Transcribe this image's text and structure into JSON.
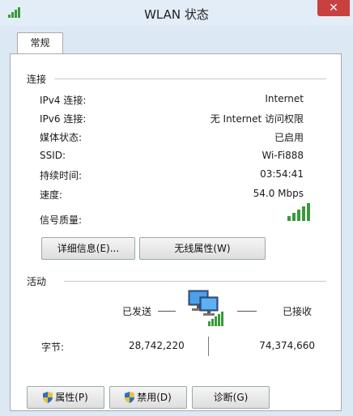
{
  "window": {
    "title": "WLAN 状态",
    "close_glyph": "✕"
  },
  "tabs": [
    {
      "label": "常规"
    }
  ],
  "connection": {
    "section_title": "连接",
    "rows": [
      {
        "label": "IPv4 连接:",
        "value": "Internet"
      },
      {
        "label": "IPv6 连接:",
        "value": "无 Internet 访问权限"
      },
      {
        "label": "媒体状态:",
        "value": "已启用"
      },
      {
        "label": "SSID:",
        "value": "Wi-Fi888"
      },
      {
        "label": "持续时间:",
        "value": "03:54:41"
      },
      {
        "label": "速度:",
        "value": "54.0 Mbps"
      }
    ],
    "signal_label": "信号质量:",
    "signal_bars_filled": 5,
    "signal_bars_total": 5,
    "details_button": "详细信息(E)...",
    "wireless_props_button": "无线属性(W)"
  },
  "activity": {
    "section_title": "活动",
    "sent_label": "已发送",
    "received_label": "已接收",
    "bytes_label": "字节:",
    "bytes_sent": "28,742,220",
    "bytes_received": "74,374,660"
  },
  "footer": {
    "properties_button": "属性(P)",
    "disable_button": "禁用(D)",
    "diagnose_button": "诊断(G)"
  },
  "colors": {
    "signal_green": "#3a9a3a",
    "accent_blue": "#2d6fc0",
    "close_red": "#c94040"
  }
}
